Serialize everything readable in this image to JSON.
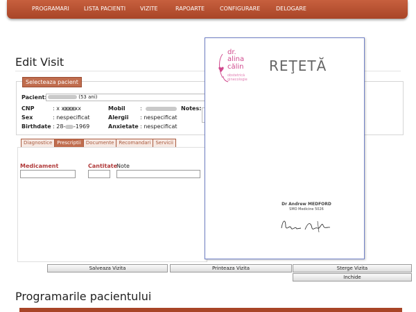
{
  "nav": {
    "items": [
      "PROGRAMARI",
      "LISTA PACIENTI",
      "VIZITE",
      "RAPOARTE",
      "CONFIGURARE",
      "DELOGARE"
    ]
  },
  "page": {
    "title": "Edit Visit",
    "select_patient_label": "Selecteaza pacient"
  },
  "patient": {
    "name_label": "Pacient:",
    "age_text": "(53 ani)",
    "cnp_label": "CNP",
    "cnp_value": ": x xxxxxx",
    "mobile_label": "Mobil",
    "mobile_value": ":",
    "notes_label": "Notes:",
    "sex_label": "Sex",
    "sex_value": ": nespecificat",
    "allergies_label": "Alergii",
    "allergies_value": ": nespecificat",
    "birthdate_label": "Birthdate",
    "birthdate_value": ": 28-",
    "birthdate_year": "-1969",
    "anxiety_label": "Anxietate",
    "anxiety_value": ": nespecificat"
  },
  "tabs": [
    {
      "label": "Diagnostice",
      "active": false
    },
    {
      "label": "Prescriptii",
      "active": true
    },
    {
      "label": "Documente",
      "active": false
    },
    {
      "label": "Recomandari",
      "active": false
    },
    {
      "label": "Servicii",
      "active": false
    }
  ],
  "prescription_form": {
    "medicament_label": "Medicament",
    "quantity_label": "Cantitate",
    "note_label": "Note"
  },
  "actions": {
    "save": "Salveaza Vizita",
    "print": "Printeaza Vizita",
    "delete": "Sterge Vizita",
    "close": "Inchide"
  },
  "appointments": {
    "title": "Programarile pacientului"
  },
  "prescription_preview": {
    "brand_dr": "dr.",
    "brand_first": "alina",
    "brand_last": "călin",
    "brand_sub1": "obstetrică",
    "brand_sub2": "ginecologie",
    "title": "REŢETĂ",
    "doctor_name": "Dr Andrew MEDFORD",
    "doctor_code": "SMO Medicine 5026",
    "accent_color": "#d04a8e"
  },
  "colors": {
    "nav": "#b4502f",
    "tab_active": "#c06d4e",
    "label_red": "#b03a3a"
  }
}
